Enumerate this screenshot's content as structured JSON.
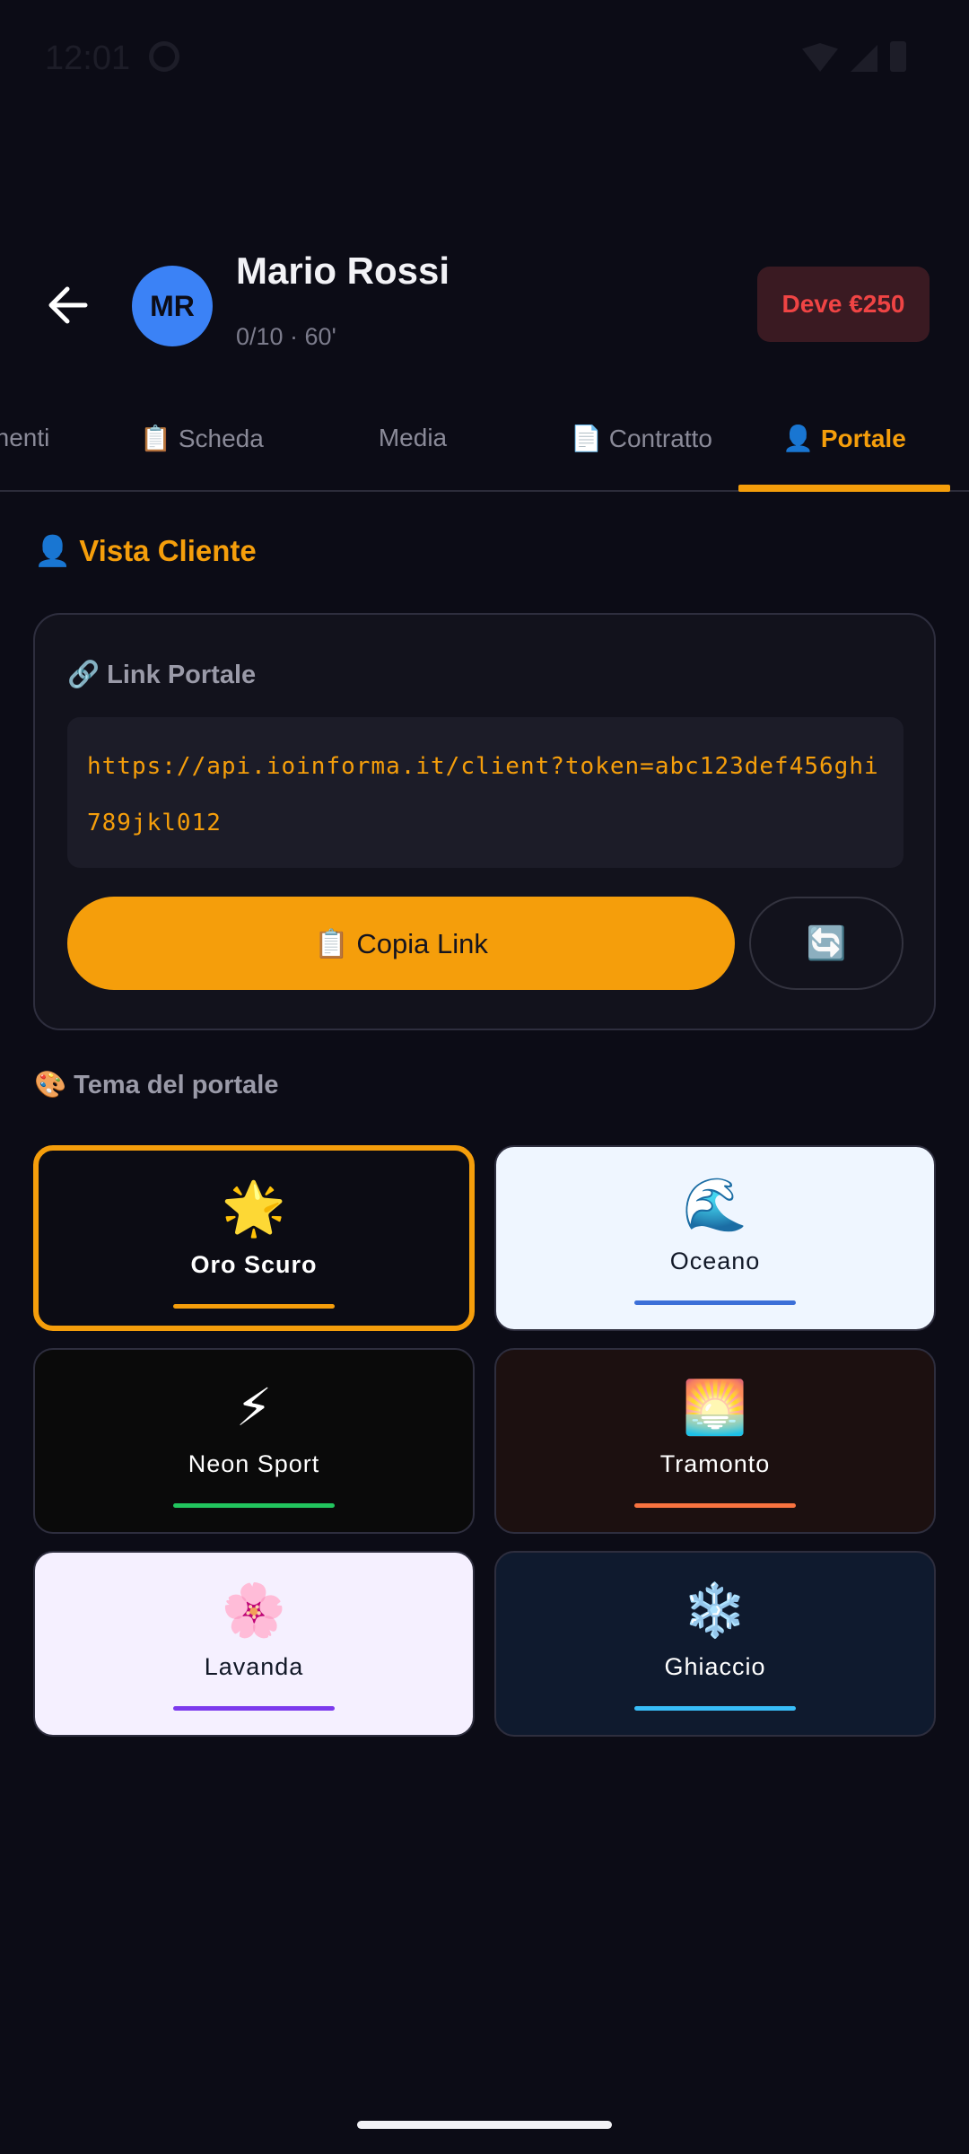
{
  "status": {
    "time": "12:01"
  },
  "header": {
    "avatar_initials": "MR",
    "name": "Mario Rossi",
    "subtitle": "0/10 · 60'",
    "debt": "Deve €250"
  },
  "tabs": [
    {
      "label": "nenti"
    },
    {
      "label": "📋 Scheda"
    },
    {
      "label": "Media"
    },
    {
      "label": "📄 Contratto"
    },
    {
      "label": "👤 Portale",
      "active": true
    }
  ],
  "section_title": "👤 Vista Cliente",
  "link_card": {
    "label": "🔗 Link Portale",
    "url": "https://api.ioinforma.it/client?token=abc123def456ghi789jkl012",
    "copy_label": "📋 Copia Link",
    "refresh_icon": "🔄"
  },
  "theme_title": "🎨 Tema del portale",
  "themes": [
    {
      "name": "Oro Scuro",
      "icon": "🌟",
      "bg": "#0c0c14",
      "text": "#ffffff",
      "accent": "#f59e0b",
      "selected": true
    },
    {
      "name": "Oceano",
      "icon": "🌊",
      "bg": "#eff6ff",
      "text": "#111827",
      "accent": "#3b6fd8"
    },
    {
      "name": "Neon Sport",
      "icon": "⚡",
      "bg": "#0a0a0a",
      "text": "#ffffff",
      "accent": "#22c55e"
    },
    {
      "name": "Tramonto",
      "icon": "🌅",
      "bg": "#1c1010",
      "text": "#ffffff",
      "accent": "#f97340"
    },
    {
      "name": "Lavanda",
      "icon": "🌸",
      "bg": "#f5f0ff",
      "text": "#111827",
      "accent": "#7c3aed"
    },
    {
      "name": "Ghiaccio",
      "icon": "❄️",
      "bg": "#0f1a2e",
      "text": "#ffffff",
      "accent": "#38bdf8"
    }
  ],
  "colors": {
    "accent": "#f59e0b",
    "background": "#0c0c16",
    "danger": "#ef4444",
    "avatar": "#3b82f6"
  }
}
